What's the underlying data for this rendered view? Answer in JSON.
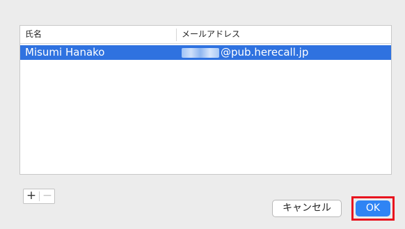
{
  "table": {
    "columns": [
      "氏名",
      "メールアドレス"
    ],
    "rows": [
      {
        "name": "Misumi Hanako",
        "email_visible": "@pub.herecall.jp",
        "selected": true
      }
    ]
  },
  "controls": {
    "add_label": "+",
    "remove_label": "−"
  },
  "buttons": {
    "cancel_label": "キャンセル",
    "ok_label": "OK"
  },
  "colors": {
    "selection": "#2f72e0",
    "ok_button": "#2f84f4",
    "highlight_frame": "#e8141e"
  }
}
